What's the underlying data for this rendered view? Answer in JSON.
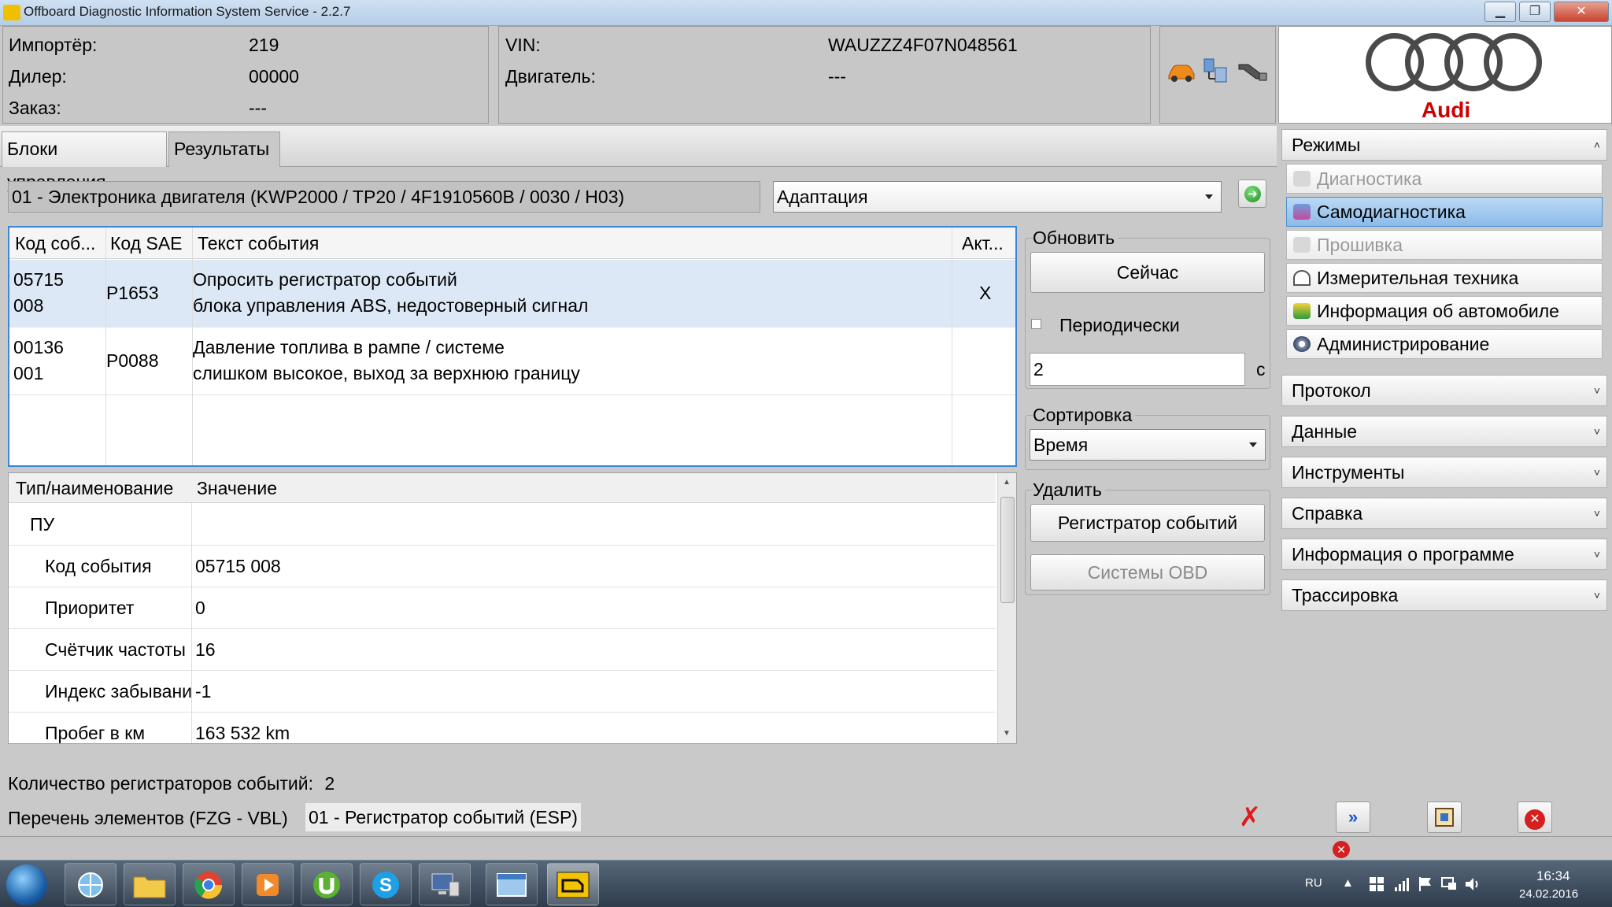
{
  "window": {
    "title": "Offboard Diagnostic Information System Service - 2.2.7",
    "minimize": "▁",
    "maximize": "❐",
    "close": "✕"
  },
  "header": {
    "importer_label": "Импортёр:",
    "importer_value": "219",
    "dealer_label": "Дилер:",
    "dealer_value": "00000",
    "order_label": "Заказ:",
    "order_value": "---",
    "vin_label": "VIN:",
    "vin_value": "WAUZZZ4F07N048561",
    "engine_label": "Двигатель:",
    "engine_value": "---",
    "brand": "Audi"
  },
  "tabs": [
    {
      "label": "Блоки управления"
    },
    {
      "label": "Результаты"
    }
  ],
  "control_unit": {
    "text": "01 - Электроника двигателя  (KWP2000 / TP20 / 4F1910560B   / 0030 / H03)",
    "function_select": "Адаптация"
  },
  "events_table": {
    "columns": [
      "Код соб...",
      "Код SAE",
      "Текст события",
      "Акт..."
    ],
    "rows": [
      {
        "code1": "05715",
        "code2": "008",
        "sae": "P1653",
        "text1": "Опросить регистратор событий",
        "text2": "блока управления ABS, недостоверный сигнал",
        "active": "X"
      },
      {
        "code1": "00136",
        "code2": "001",
        "sae": "P0088",
        "text1": "Давление топлива в рампе / системе",
        "text2": "слишком высокое, выход за верхнюю границу",
        "active": ""
      }
    ]
  },
  "update_group": {
    "label": "Обновить",
    "now_button": "Сейчас",
    "periodic_label": "Периодически",
    "period_value": "2",
    "unit": "с"
  },
  "sort_group": {
    "label": "Сортировка",
    "value": "Время"
  },
  "delete_group": {
    "label": "Удалить",
    "event_recorder_button": "Регистратор событий",
    "obd_button": "Системы OBD"
  },
  "details_table": {
    "columns": [
      "Тип/наименование",
      "Значение"
    ],
    "rows": [
      {
        "name": "ПУ",
        "value": ""
      },
      {
        "name": "Код события",
        "value": "05715 008"
      },
      {
        "name": "Приоритет",
        "value": "0"
      },
      {
        "name": "Счётчик частоты",
        "value": "16"
      },
      {
        "name": "Индекс забывани",
        "value": "-1"
      },
      {
        "name": "Пробег в км",
        "value": "163 532 km"
      }
    ]
  },
  "footer": {
    "count_label": "Количество регистраторов событий:",
    "count_value": "2",
    "list_label": "Перечень элементов (FZG - VBL)",
    "list_value": "01 - Регистратор событий (ESP)"
  },
  "sidebar": {
    "modes_label": "Режимы",
    "modes": [
      {
        "label": "Диагностика",
        "state": "disabled"
      },
      {
        "label": "Самодиагностика",
        "state": "active"
      },
      {
        "label": "Прошивка",
        "state": "disabled"
      },
      {
        "label": "Измерительная техника",
        "state": "normal"
      },
      {
        "label": "Информация об автомобиле",
        "state": "normal"
      },
      {
        "label": "Администрирование",
        "state": "normal"
      }
    ],
    "sections": [
      "Протокол",
      "Данные",
      "Инструменты",
      "Справка",
      "Информация о программе",
      "Трассировка"
    ],
    "chevron_up": "˄",
    "chevron_down": "˅"
  },
  "toolbar": {
    "forward": "»",
    "exit": "✕"
  },
  "taskbar": {
    "lang": "RU",
    "time": "16:34",
    "date": "24.02.2016"
  },
  "colors": {
    "accent": "#3b86d6",
    "audi_red": "#cc0000",
    "error_red": "#d42020"
  }
}
